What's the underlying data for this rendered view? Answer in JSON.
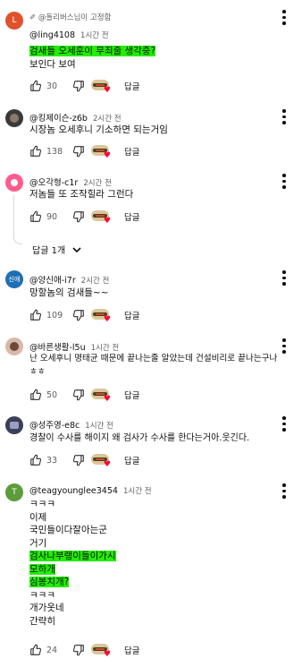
{
  "comments": [
    {
      "pinned_label": "@돌리버스님이 고정함",
      "handle": "@ling4108",
      "time": "1시간 전",
      "lines": [
        "검새들 오세훈이 무죄줄 생각중?",
        "보인다 보여"
      ],
      "highlight": [
        true,
        false
      ],
      "likes": "30",
      "reply_label": "답글",
      "avatar_letter": "L",
      "avatar_color": "#e0522c"
    },
    {
      "handle": "@킹제이슨-z6b",
      "time": "2시간 전",
      "lines": [
        "시장놈 오세후니 기소하면 되는거임"
      ],
      "likes": "138",
      "reply_label": "답글",
      "avatar_color": "#3a3a3a"
    },
    {
      "handle": "@오각형-c1r",
      "time": "2시간 전",
      "lines": [
        "저놈들 또 조작힐라 그런다"
      ],
      "likes": "90",
      "reply_label": "답글",
      "avatar_color": "#ff5d8f",
      "replies_toggle": "답글 1개"
    },
    {
      "handle": "@양신애-i7r",
      "time": "2시간 전",
      "lines": [
        "망할놈의 검새들~~"
      ],
      "likes": "109",
      "reply_label": "답글",
      "avatar_letter": "신애",
      "avatar_color": "#1f6fb5"
    },
    {
      "handle": "@바른생활-l5u",
      "time": "1시간 전",
      "lines": [
        "난 오세후니 명태균 때문에 끝나는줄 알았는데 건설비리로 끝나는구나",
        "ㅎㅎ"
      ],
      "likes": "50",
      "reply_label": "답글",
      "avatar_color": "#d9b8a8"
    },
    {
      "handle": "@성주영-e8c",
      "time": "1시간 전",
      "lines": [
        "경찰이 수사를 해이지 왜 검사가 수사를 한다는거아.웃긴다."
      ],
      "likes": "33",
      "reply_label": "답글",
      "avatar_color": "#3c3f5a"
    },
    {
      "handle": "@teagyounglee3454",
      "time": "1시간 전",
      "lines": [
        "ㅋㅋㅋ",
        "이제",
        "국민들이다잘아는군",
        "거기",
        "검사나부랭이들이가시",
        "모하개",
        "심봉치개?",
        "ㅋㅋㅋ",
        "개가옷네",
        "간략히"
      ],
      "highlight": [
        false,
        false,
        false,
        false,
        true,
        true,
        true,
        false,
        false,
        false
      ],
      "likes": "24",
      "reply_label": "답글",
      "avatar_letter": "T",
      "avatar_color": "#5d9c3a"
    }
  ]
}
